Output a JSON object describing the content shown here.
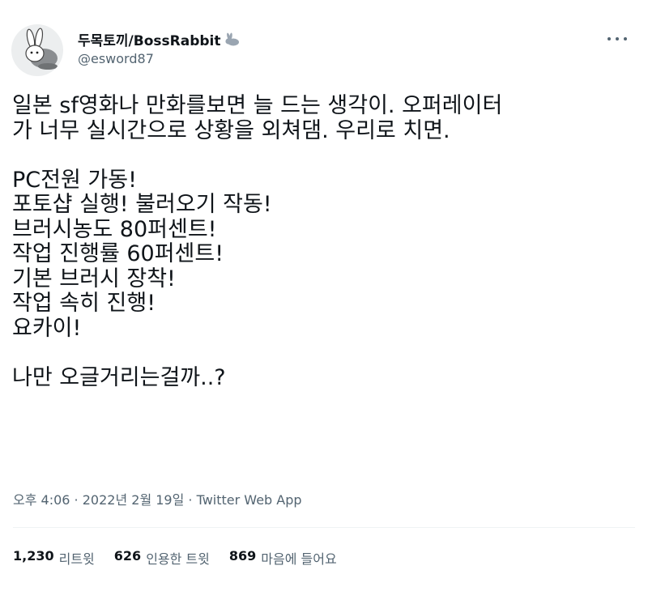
{
  "user": {
    "display_name": "두목토끼/BossRabbit",
    "handle": "@esword87",
    "avatar_icon": "rabbit-avatar-icon",
    "name_emoji_icon": "rabbit-icon"
  },
  "tweet": {
    "lines": [
      "일본 sf영화나 만화를보면 늘 드는 생각이. 오퍼레이터",
      "가 너무 실시간으로 상황을 외쳐댐. 우리로 치면.",
      "",
      "PC전원 가동!",
      "포토샵 실행! 불러오기 작동!",
      "브러시농도 80퍼센트!",
      "작업 진행률 60퍼센트!",
      "기본 브러시 장착!",
      "작업 속히 진행!",
      "요카이!",
      "",
      "나만 오글거리는걸까..?"
    ]
  },
  "meta": {
    "time": "오후 4:06",
    "separator": " · ",
    "date": "2022년 2월 19일",
    "app": "Twitter Web App"
  },
  "stats": {
    "retweets_count": "1,230",
    "retweets_label": "리트윗",
    "quotes_count": "626",
    "quotes_label": "인용한 트윗",
    "likes_count": "869",
    "likes_label": "마음에 들어요"
  },
  "colors": {
    "text": "#0f1419",
    "secondary": "#536471",
    "divider": "#eff3f4"
  }
}
